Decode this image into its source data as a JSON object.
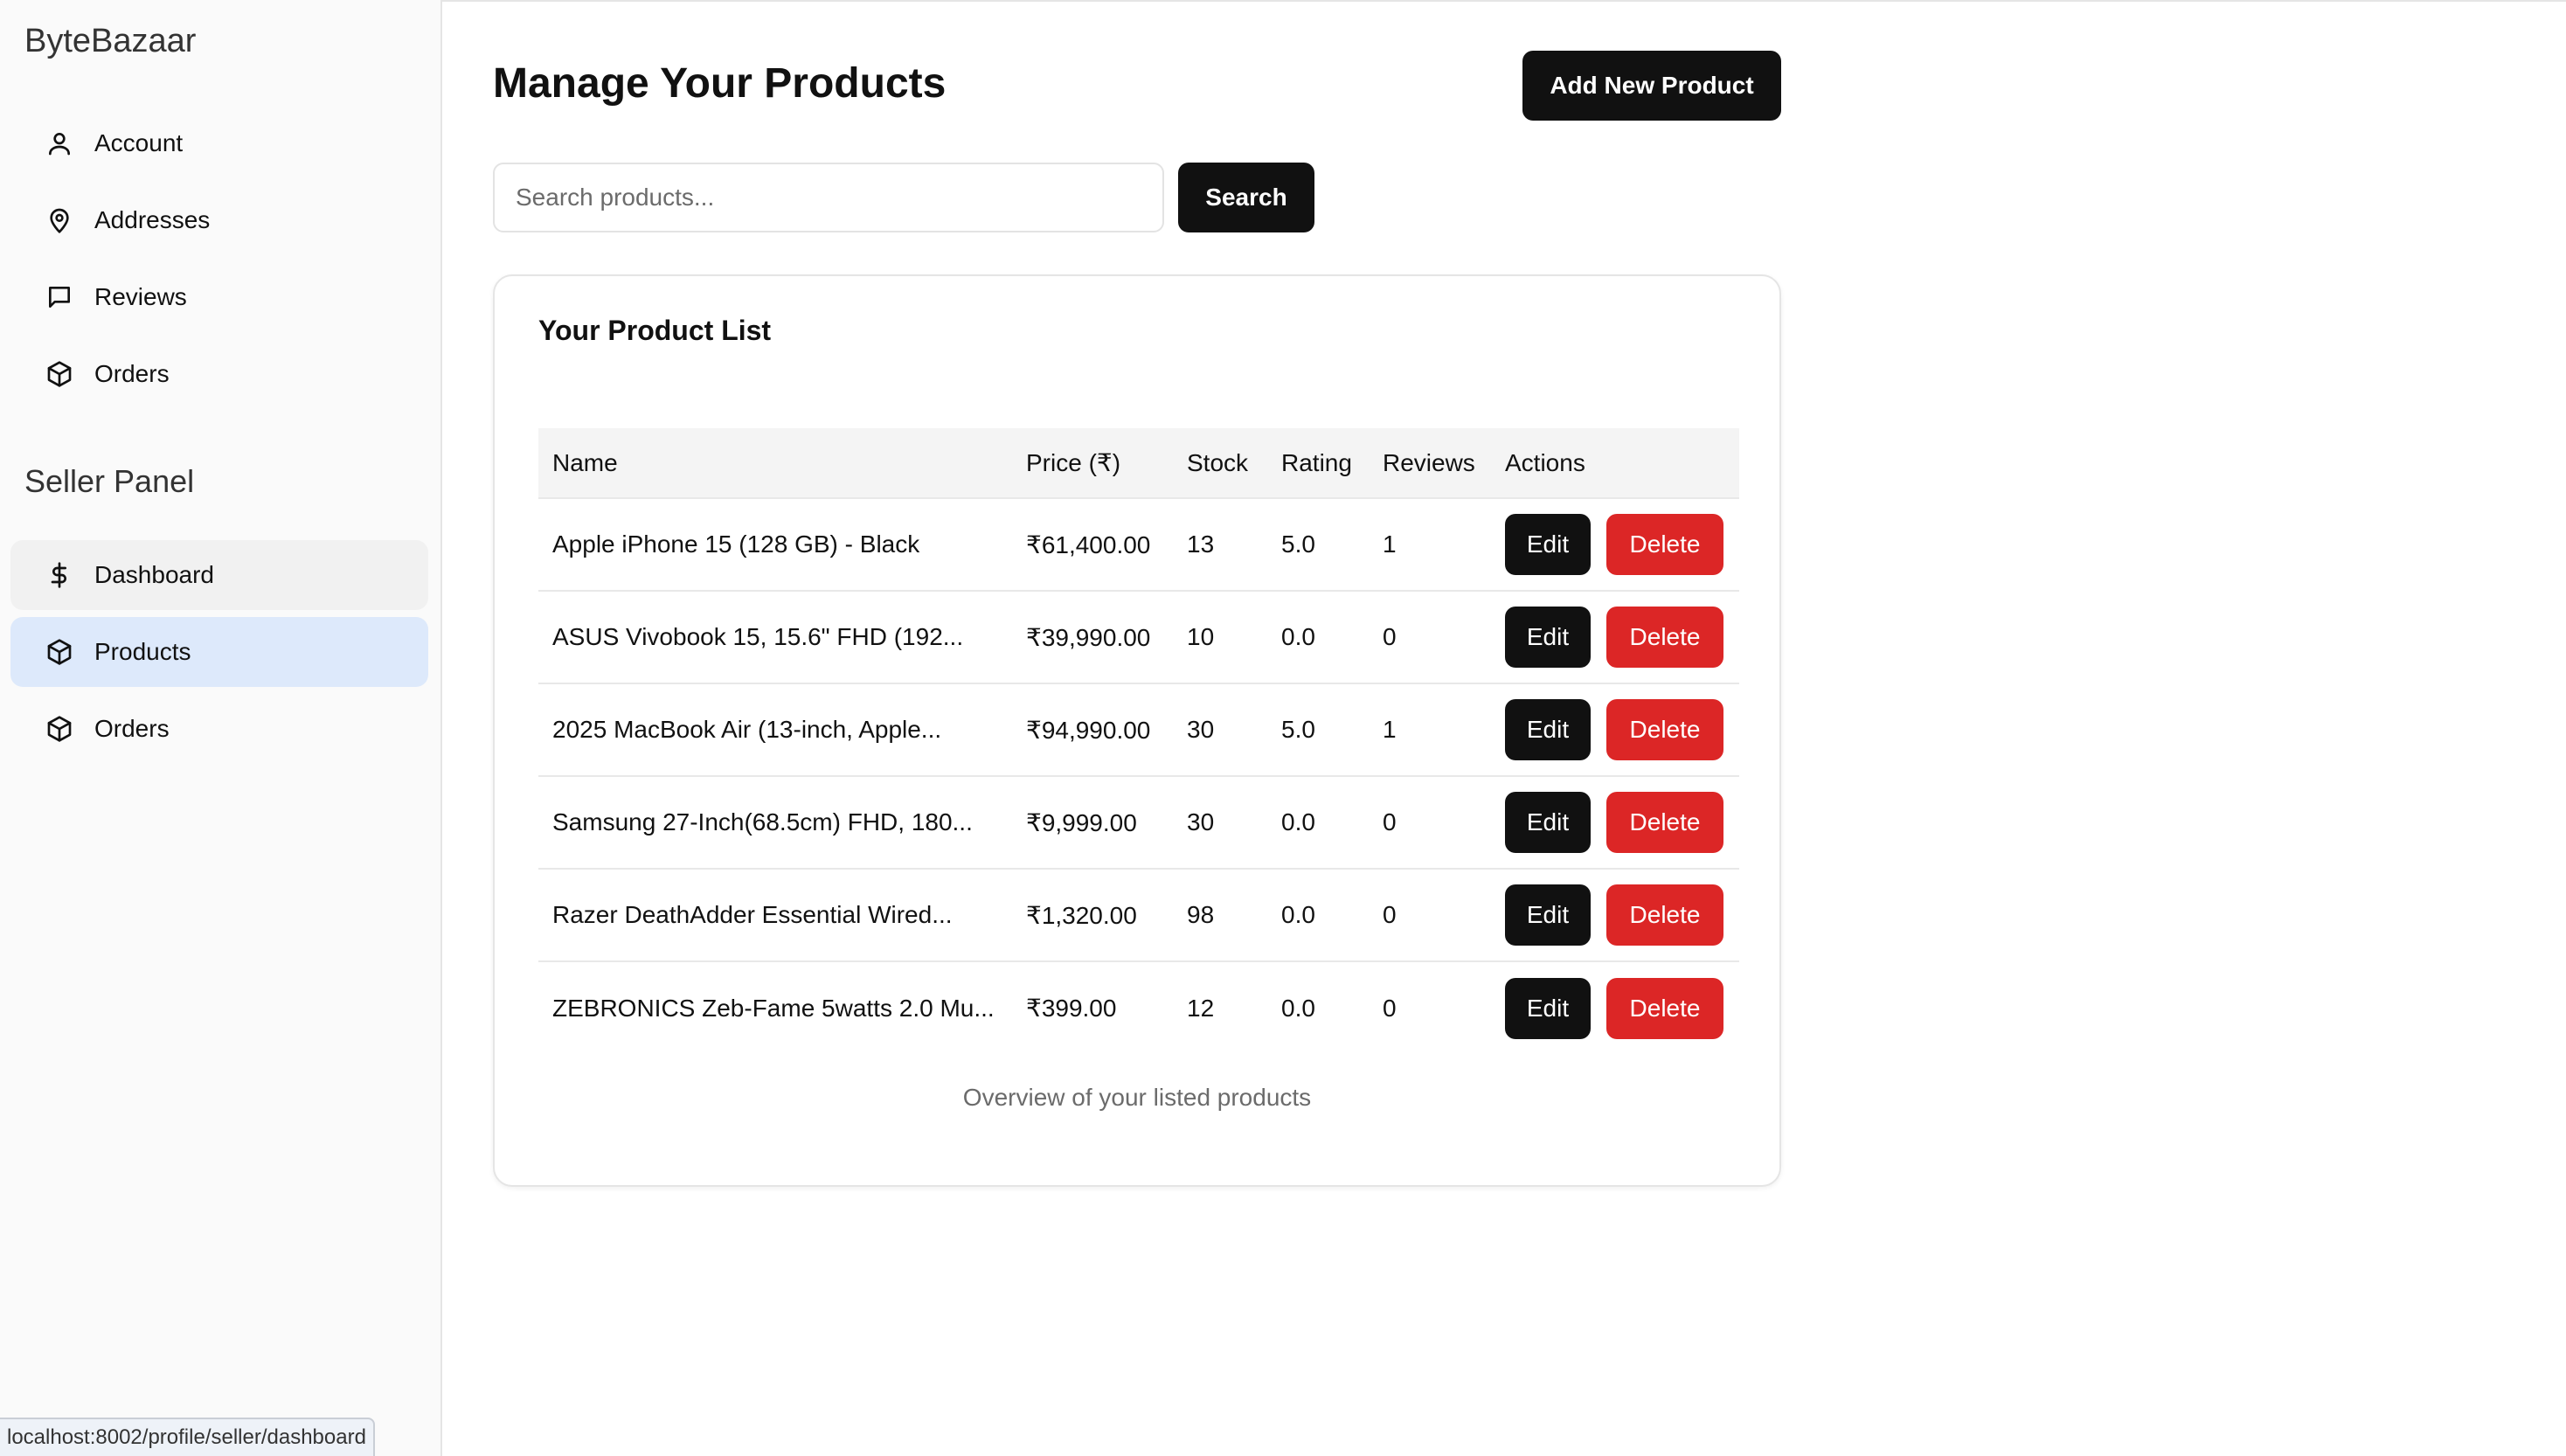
{
  "brand": "ByteBazaar",
  "sidebar": {
    "account_items": [
      {
        "label": "Account",
        "icon": "user-icon"
      },
      {
        "label": "Addresses",
        "icon": "map-pin-icon"
      },
      {
        "label": "Reviews",
        "icon": "message-square-icon"
      },
      {
        "label": "Orders",
        "icon": "package-icon"
      }
    ],
    "seller_title": "Seller Panel",
    "seller_items": [
      {
        "label": "Dashboard",
        "icon": "dollar-icon",
        "state": "hover"
      },
      {
        "label": "Products",
        "icon": "package-icon",
        "state": "active"
      },
      {
        "label": "Orders",
        "icon": "package-icon",
        "state": "normal"
      }
    ]
  },
  "main": {
    "title": "Manage Your Products",
    "add_button": "Add New Product",
    "search": {
      "placeholder": "Search products...",
      "value": "",
      "button": "Search"
    },
    "card": {
      "title": "Your Product List",
      "columns": [
        "Name",
        "Price (₹)",
        "Stock",
        "Rating",
        "Reviews",
        "Actions"
      ],
      "rows": [
        {
          "name": "Apple iPhone 15 (128 GB) - Black",
          "price": "₹61,400.00",
          "stock": "13",
          "rating": "5.0",
          "reviews": "1"
        },
        {
          "name": "ASUS Vivobook 15, 15.6\" FHD (192...",
          "price": "₹39,990.00",
          "stock": "10",
          "rating": "0.0",
          "reviews": "0"
        },
        {
          "name": "2025 MacBook Air (13-inch, Apple...",
          "price": "₹94,990.00",
          "stock": "30",
          "rating": "5.0",
          "reviews": "1"
        },
        {
          "name": "Samsung 27-Inch(68.5cm) FHD, 180...",
          "price": "₹9,999.00",
          "stock": "30",
          "rating": "0.0",
          "reviews": "0"
        },
        {
          "name": "Razer DeathAdder Essential Wired...",
          "price": "₹1,320.00",
          "stock": "98",
          "rating": "0.0",
          "reviews": "0"
        },
        {
          "name": "ZEBRONICS Zeb-Fame 5watts 2.0 Mu...",
          "price": "₹399.00",
          "stock": "12",
          "rating": "0.0",
          "reviews": "0"
        }
      ],
      "edit_label": "Edit",
      "delete_label": "Delete",
      "caption": "Overview of your listed products"
    }
  },
  "status_bar": "localhost:8002/profile/seller/dashboard",
  "colors": {
    "accent_dark": "#111111",
    "danger": "#dc2626",
    "active_nav": "#dde9fb"
  }
}
